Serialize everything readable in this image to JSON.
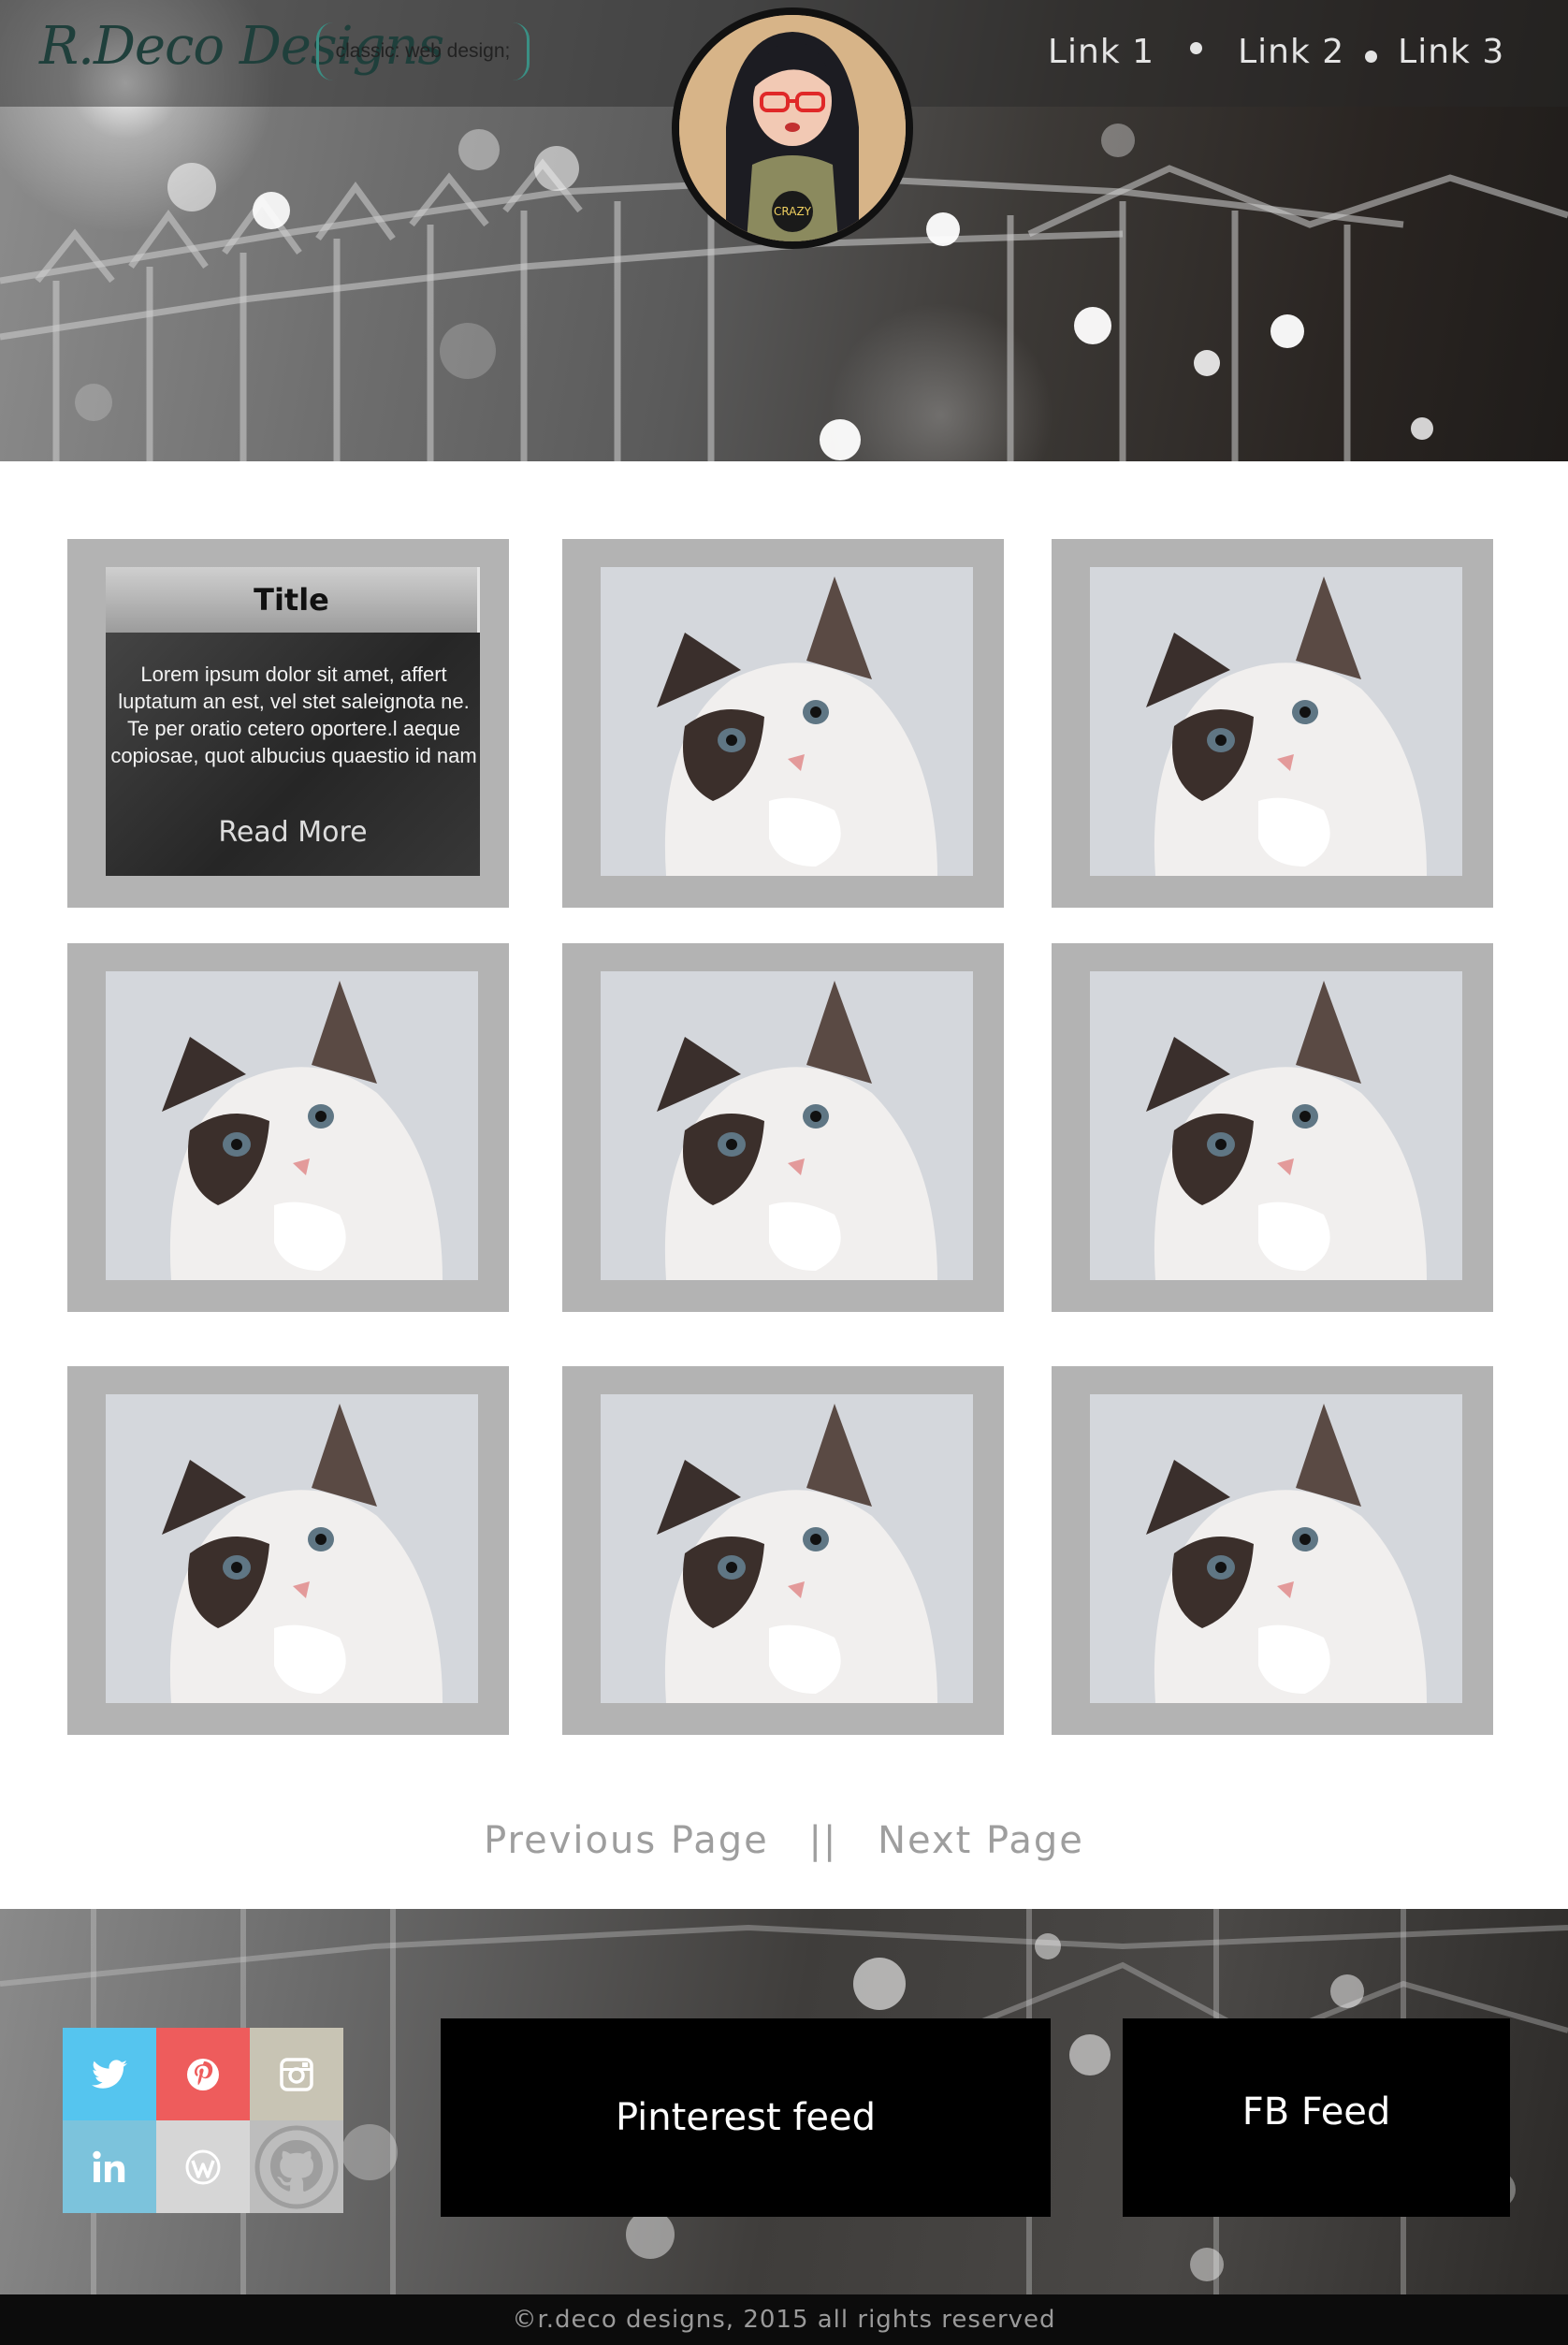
{
  "header": {
    "logo_text": "R.Deco Designs",
    "logo_tagline": "classic: web design;",
    "nav": [
      "Link 1",
      "Link 2",
      "Link 3"
    ]
  },
  "feature_card": {
    "title": "Title",
    "body": "Lorem ipsum dolor sit amet, affert luptatum an est, vel stet saleignota ne. Te per oratio cetero oportere.l aeque copiosae, quot albucius quaestio id nam",
    "read_more": "Read More"
  },
  "gallery": {
    "image_icon": "cat-photo",
    "count": 8
  },
  "pagination": {
    "previous": "Previous Page",
    "separator": "||",
    "next": "Next Page"
  },
  "footer": {
    "social": [
      {
        "icon": "twitter-icon",
        "color": "#55c5ef"
      },
      {
        "icon": "pinterest-icon",
        "color": "#ee5c5c"
      },
      {
        "icon": "instagram-icon",
        "color": "#c8c4b4"
      },
      {
        "icon": "linkedin-icon",
        "color": "#7cc3dc"
      },
      {
        "icon": "wordpress-icon",
        "color": "#d6d6d6"
      },
      {
        "icon": "github-icon",
        "color": "#bdbdbd"
      }
    ],
    "pinterest_feed": "Pinterest feed",
    "fb_feed": "FB Feed",
    "copyright": "©r.deco designs, 2015 all rights reserved"
  }
}
